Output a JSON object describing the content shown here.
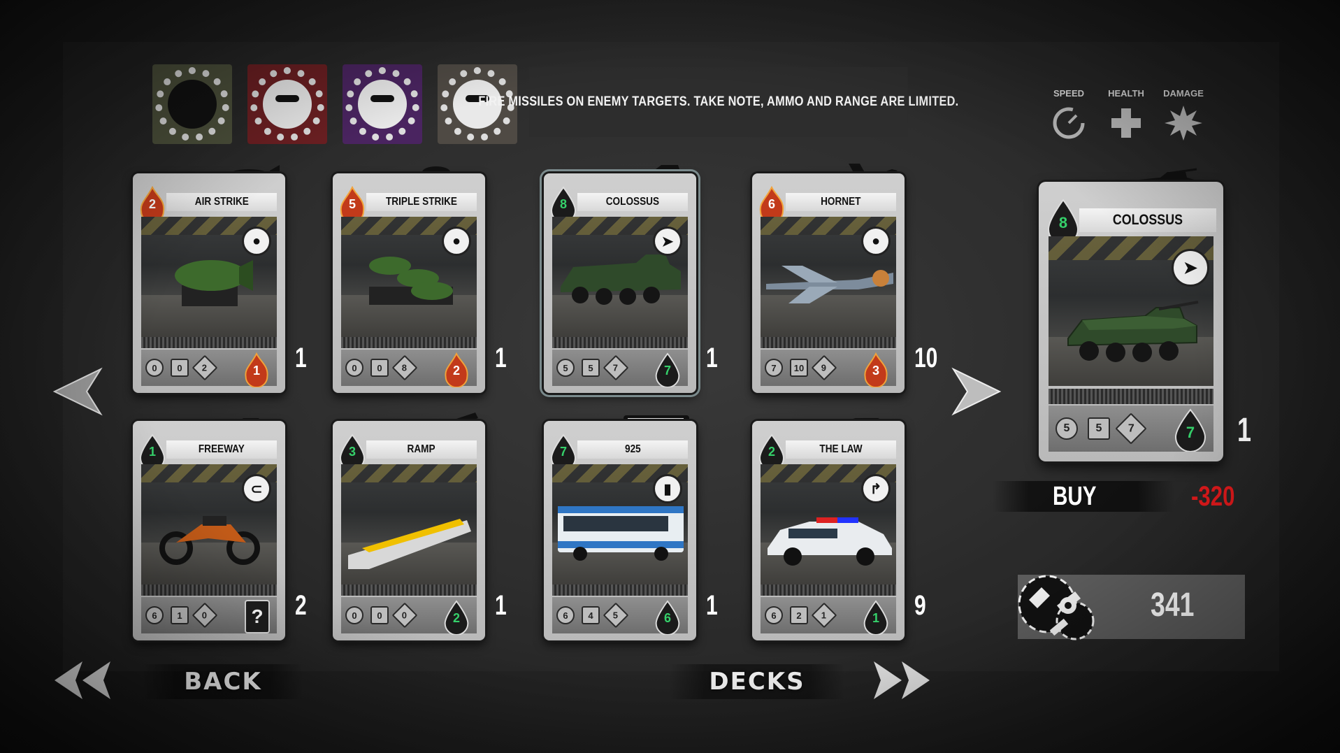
{
  "gangs": [
    {
      "name": "gang-1",
      "color": "#4b4f3a"
    },
    {
      "name": "gang-2",
      "color": "#6b1f22"
    },
    {
      "name": "gang-3",
      "color": "#4a2460"
    },
    {
      "name": "gang-4",
      "color": "#4f4a44"
    }
  ],
  "description": "FIRE MISSILES ON ENEMY TARGETS. TAKE NOTE, AMMO AND RANGE ARE LIMITED.",
  "legend": {
    "speed": "SPEED",
    "health": "HEALTH",
    "damage": "DAMAGE"
  },
  "cards": [
    {
      "title": "AIR STRIKE",
      "cost": "2",
      "cost_type": "fire",
      "speed": "0",
      "health": "0",
      "damage": "2",
      "bottom": "1",
      "bottom_type": "fire",
      "count": "1",
      "ability": "bomb-icon",
      "vehicle": "bomb"
    },
    {
      "title": "TRIPLE STRIKE",
      "cost": "5",
      "cost_type": "fire",
      "speed": "0",
      "health": "0",
      "damage": "8",
      "bottom": "2",
      "bottom_type": "fire",
      "count": "1",
      "ability": "bomb-icon",
      "vehicle": "bombs"
    },
    {
      "title": "COLOSSUS",
      "cost": "8",
      "cost_type": "oil",
      "speed": "5",
      "health": "5",
      "damage": "7",
      "bottom": "7",
      "bottom_type": "oil",
      "count": "1",
      "ability": "missile-icon",
      "vehicle": "apc",
      "selected": true
    },
    {
      "title": "HORNET",
      "cost": "6",
      "cost_type": "fire",
      "speed": "7",
      "health": "10",
      "damage": "9",
      "bottom": "3",
      "bottom_type": "fire",
      "count": "10",
      "ability": "bomb-icon",
      "vehicle": "plane"
    },
    {
      "title": "FREEWAY",
      "cost": "1",
      "cost_type": "oil",
      "speed": "6",
      "health": "1",
      "damage": "0",
      "bottom": "?",
      "bottom_type": "unknown",
      "count": "2",
      "ability": "magnet-icon",
      "vehicle": "bike"
    },
    {
      "title": "RAMP",
      "cost": "3",
      "cost_type": "oil",
      "speed": "0",
      "health": "0",
      "damage": "0",
      "bottom": "2",
      "bottom_type": "oil",
      "count": "1",
      "ability": "none",
      "vehicle": "ramp"
    },
    {
      "title": "925",
      "cost": "7",
      "cost_type": "oil",
      "speed": "6",
      "health": "4",
      "damage": "5",
      "bottom": "6",
      "bottom_type": "oil",
      "count": "1",
      "ability": "battery-icon",
      "vehicle": "bus"
    },
    {
      "title": "THE LAW",
      "cost": "2",
      "cost_type": "oil",
      "speed": "6",
      "health": "2",
      "damage": "1",
      "bottom": "1",
      "bottom_type": "oil",
      "count": "9",
      "ability": "turn-icon",
      "vehicle": "police"
    }
  ],
  "detail": {
    "title": "COLOSSUS",
    "cost": "8",
    "speed": "5",
    "health": "5",
    "damage": "7",
    "bottom": "7",
    "count": "1"
  },
  "buy": {
    "label": "BUY",
    "price": "-320"
  },
  "currency": {
    "value": "341"
  },
  "nav": {
    "back": "BACK",
    "decks": "DECKS"
  },
  "colors": {
    "fire": "#c23a1a",
    "oil": "#1e1e1e",
    "oil_text": "#35d06a",
    "price": "#e0191b"
  }
}
